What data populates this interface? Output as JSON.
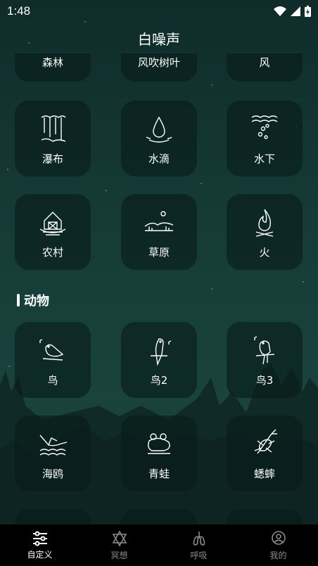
{
  "status": {
    "time": "1:48"
  },
  "header": {
    "title": "白噪声"
  },
  "nature_row_partial": [
    {
      "label": "森林",
      "icon": "forest-icon"
    },
    {
      "label": "风吹树叶",
      "icon": "leaves-icon"
    },
    {
      "label": "风",
      "icon": "wind-icon"
    }
  ],
  "nature": [
    {
      "label": "瀑布",
      "icon": "waterfall-icon"
    },
    {
      "label": "水滴",
      "icon": "water-drop-icon"
    },
    {
      "label": "水下",
      "icon": "underwater-icon"
    },
    {
      "label": "农村",
      "icon": "barn-icon"
    },
    {
      "label": "草原",
      "icon": "grassland-icon"
    },
    {
      "label": "火",
      "icon": "fire-icon"
    }
  ],
  "animals": {
    "title": "动物",
    "items": [
      {
        "label": "鸟",
        "icon": "bird-icon"
      },
      {
        "label": "鸟2",
        "icon": "parrot-icon"
      },
      {
        "label": "鸟3",
        "icon": "bird-perched-icon"
      },
      {
        "label": "海鸥",
        "icon": "seagull-icon"
      },
      {
        "label": "青蛙",
        "icon": "frog-icon"
      },
      {
        "label": "蟋蟀",
        "icon": "cricket-icon"
      }
    ]
  },
  "tabs": [
    {
      "label": "自定义",
      "icon": "sliders-icon",
      "active": true
    },
    {
      "label": "冥想",
      "icon": "star-of-david-icon",
      "active": false
    },
    {
      "label": "呼吸",
      "icon": "lungs-icon",
      "active": false
    },
    {
      "label": "我的",
      "icon": "user-icon",
      "active": false
    }
  ],
  "colors": {
    "background": "#163b36",
    "card": "#0a1f1d",
    "tabbar": "#000000",
    "tab_active": "#ffffff",
    "tab_inactive": "#8a8a8a"
  }
}
